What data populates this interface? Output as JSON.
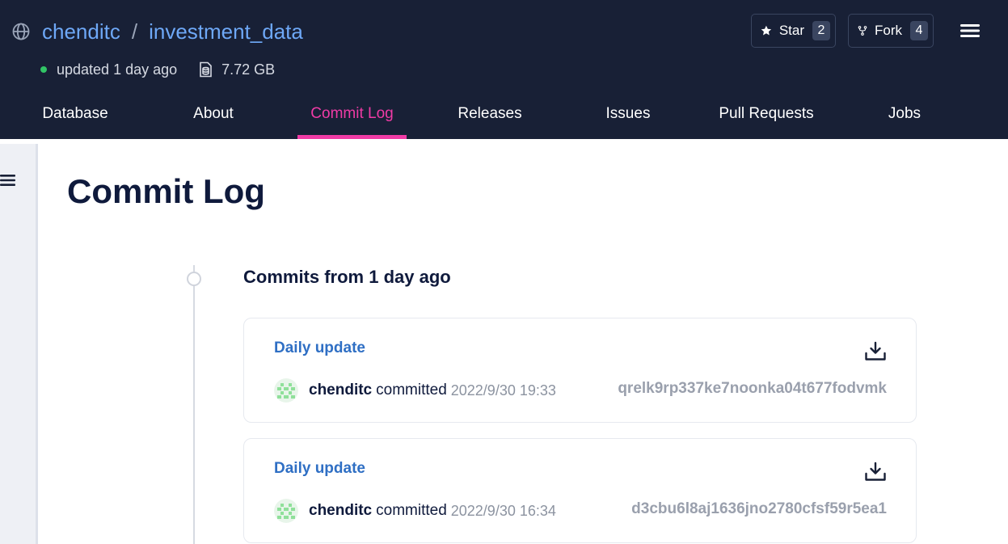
{
  "repo": {
    "owner": "chenditc",
    "separator": "/",
    "name": "investment_data",
    "updated": "updated 1 day ago",
    "size": "7.72 GB"
  },
  "actions": {
    "star_label": "Star",
    "star_count": "2",
    "fork_label": "Fork",
    "fork_count": "4"
  },
  "tabs": [
    {
      "label": "Database"
    },
    {
      "label": "About"
    },
    {
      "label": "Commit Log",
      "active": true
    },
    {
      "label": "Releases"
    },
    {
      "label": "Issues"
    },
    {
      "label": "Pull Requests"
    },
    {
      "label": "Jobs"
    }
  ],
  "page": {
    "title": "Commit Log",
    "group_heading": "Commits from 1 day ago"
  },
  "commits": [
    {
      "message": "Daily update",
      "author": "chenditc",
      "action": "committed",
      "date": "2022/9/30 19:33",
      "hash": "qrelk9rp337ke7noonka04t677fodvmk"
    },
    {
      "message": "Daily update",
      "author": "chenditc",
      "action": "committed",
      "date": "2022/9/30 16:34",
      "hash": "d3cbu6l8aj1636jno2780cfsf59r5ea1"
    }
  ],
  "colors": {
    "header_bg": "#182036",
    "active_tab": "#f03ba6",
    "link": "#6ea8f7",
    "commit_link": "#2f6fc4",
    "status_green": "#31c466"
  },
  "icons": [
    "globe-icon",
    "database-size-icon",
    "star-icon",
    "fork-icon",
    "hamburger-menu-icon",
    "download-icon",
    "avatar"
  ]
}
